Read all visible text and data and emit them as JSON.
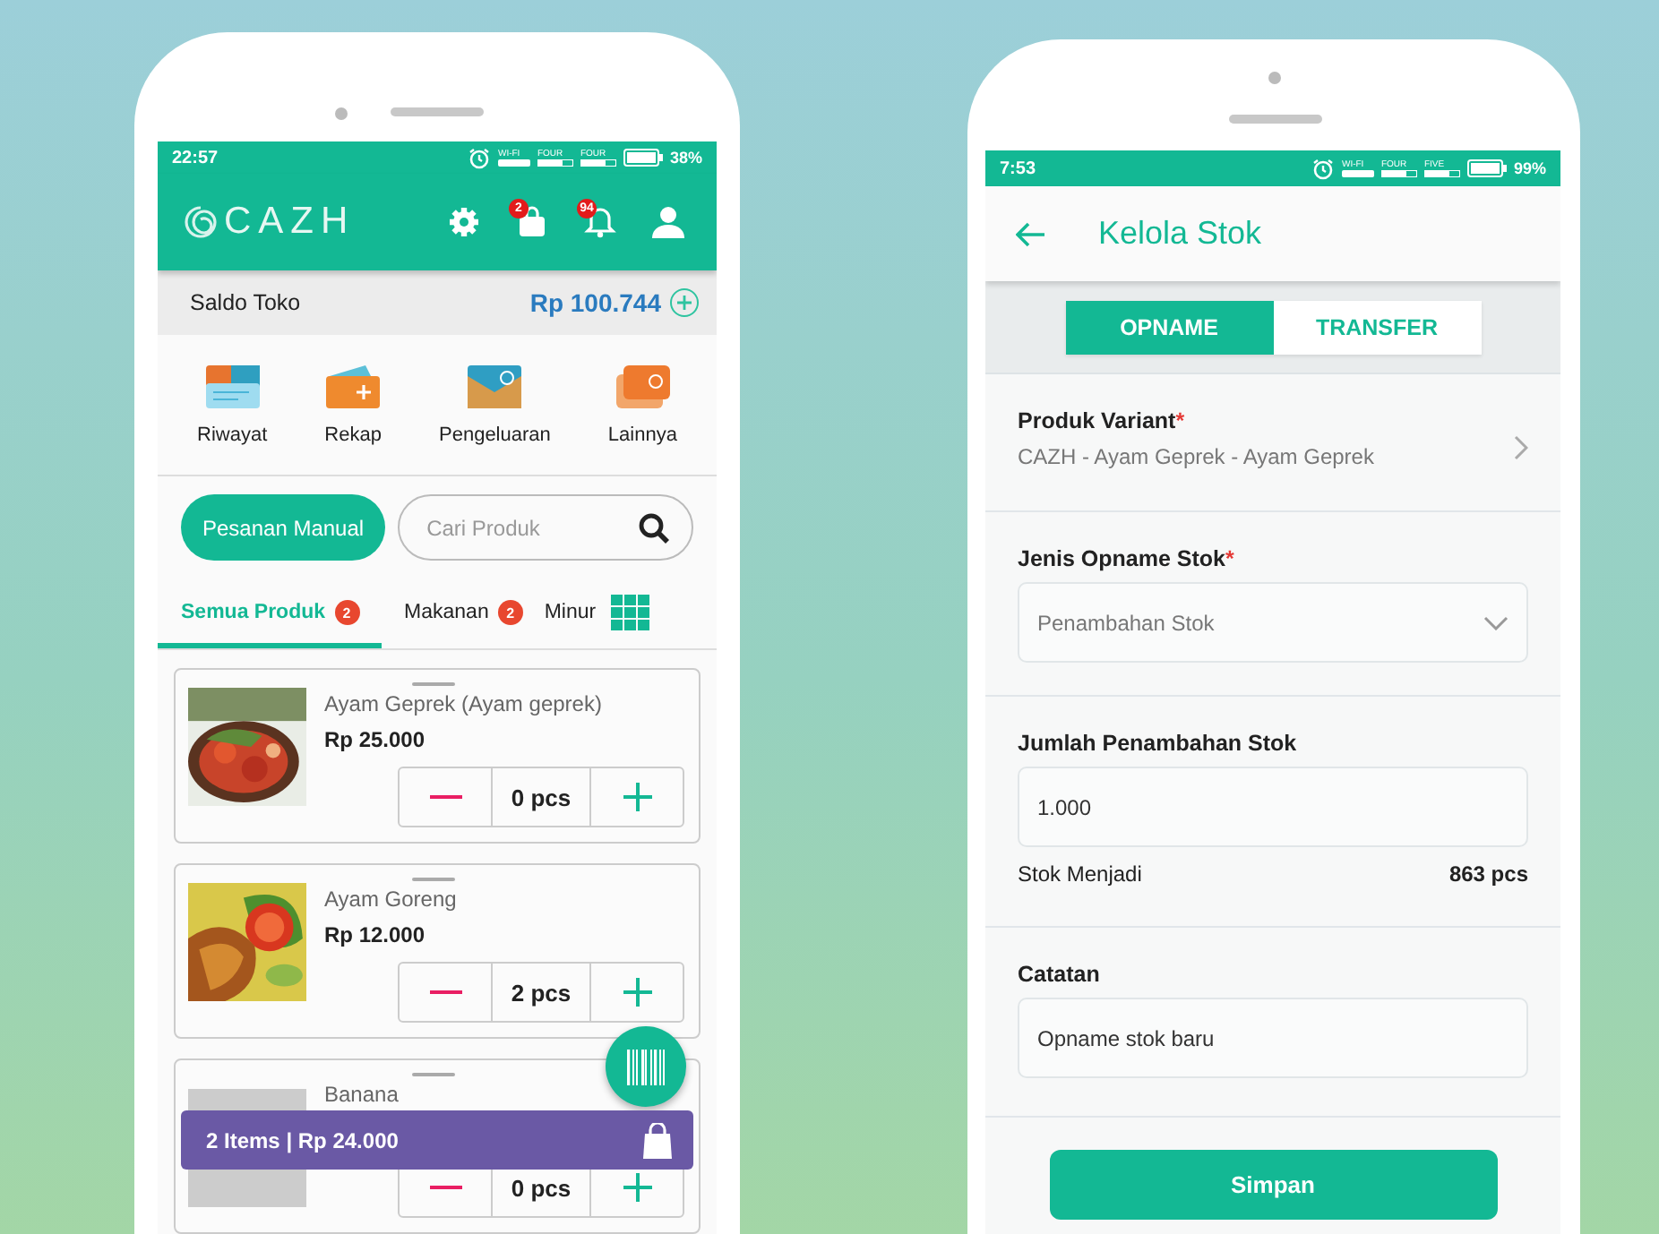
{
  "pos_screen": {
    "status_bar": {
      "time": "22:57",
      "wifi_label": "WI-FI",
      "sim_labels": [
        "FOUR",
        "FOUR"
      ],
      "battery": "38%"
    },
    "app_bar": {
      "logo": "CAZH",
      "icons": [
        {
          "kind": "settings"
        },
        {
          "kind": "bag",
          "badge": "2"
        },
        {
          "kind": "bell",
          "badge": "94"
        },
        {
          "kind": "account"
        }
      ]
    },
    "balance": {
      "label": "Saldo Toko",
      "amount": "Rp 100.744"
    },
    "shortcuts": [
      {
        "kind": "history",
        "label": "Riwayat"
      },
      {
        "kind": "recap",
        "label": "Rekap"
      },
      {
        "kind": "expense",
        "label": "Pengeluaran"
      },
      {
        "kind": "more",
        "label": "Lainnya"
      }
    ],
    "manual_order_button": "Pesanan Manual",
    "search": {
      "placeholder": "Cari Produk"
    },
    "category_tabs": [
      {
        "label": "Semua Produk",
        "badge": "2",
        "selected": true
      },
      {
        "label": "Makanan",
        "badge": "2",
        "selected": false
      },
      {
        "label": "Minur",
        "selected": false
      }
    ],
    "products": [
      {
        "kind": "picture",
        "name": "Ayam Geprek (Ayam geprek)",
        "price": "Rp 25.000",
        "quantity": "0 pcs"
      },
      {
        "kind": "picture",
        "name": "Ayam Goreng",
        "price": "Rp 12.000",
        "quantity": "2 pcs"
      },
      {
        "kind": "placeholder",
        "name": "Banana",
        "quantity": "0 pcs"
      }
    ],
    "cart_bar": {
      "summary": "2 Items | Rp 24.000"
    }
  },
  "stock_screen": {
    "status_bar": {
      "time": "7:53",
      "wifi_label": "WI-FI",
      "sim_labels": [
        "FOUR",
        "FIVE"
      ],
      "battery": "99%"
    },
    "title": "Kelola Stok",
    "tabs": [
      {
        "label": "OPNAME",
        "selected": true
      },
      {
        "label": "TRANSFER",
        "selected": false
      }
    ],
    "fields": [
      {
        "kind": "link",
        "label": "Produk Variant",
        "required_mark": "*",
        "value": "CAZH - Ayam Geprek - Ayam Geprek"
      },
      {
        "kind": "select",
        "label": "Jenis Opname Stok",
        "required_mark": "*",
        "value": "Penambahan Stok"
      },
      {
        "kind": "input",
        "label": "Jumlah Penambahan Stok",
        "value": "1.000",
        "note_label": "Stok Menjadi",
        "note_value": "863 pcs"
      },
      {
        "kind": "input",
        "label": "Catatan",
        "value": "Opname stok baru"
      }
    ],
    "save_button": "Simpan"
  }
}
